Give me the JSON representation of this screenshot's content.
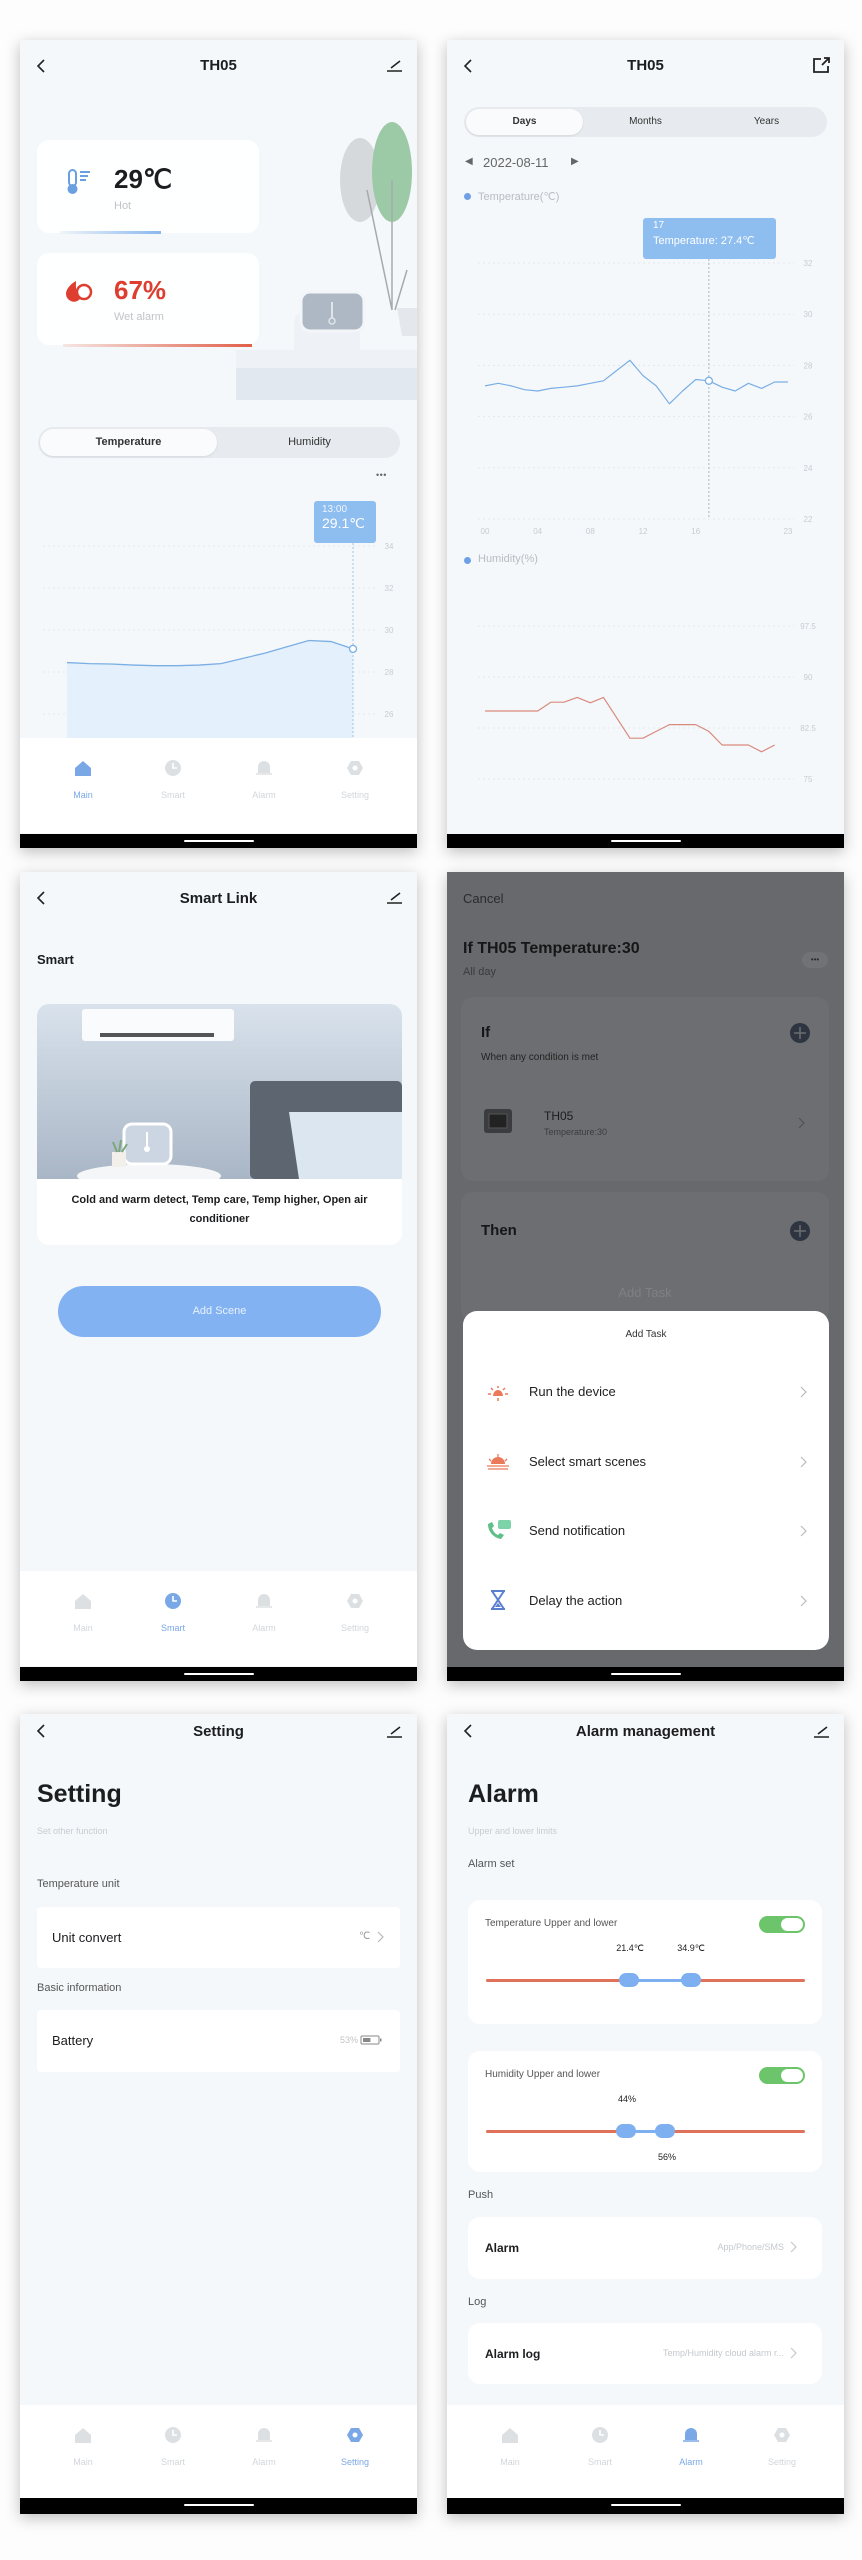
{
  "colors": {
    "accent": "#7aa8e6",
    "alarm": "#e04a3a",
    "toggle_on": "#6cc56a",
    "humidity_line": "#d98a7e",
    "temp_line": "#7aaee4"
  },
  "nav": {
    "items": [
      "Main",
      "Smart",
      "Alarm",
      "Setting"
    ],
    "icons": [
      "home-icon",
      "clock-icon",
      "bell-icon",
      "gear-icon"
    ]
  },
  "main": {
    "title": "TH05",
    "temperature": {
      "value": "29℃",
      "status": "Hot"
    },
    "humidity": {
      "value": "67%",
      "status": "Wet alarm"
    },
    "tabs": [
      "Temperature",
      "Humidity"
    ],
    "active_tab": 0,
    "more": "• • •",
    "tooltip": {
      "time": "13:00",
      "value": "29.1℃"
    },
    "nav_active": 0
  },
  "history": {
    "title": "TH05",
    "tabs": [
      "Days",
      "Months",
      "Years"
    ],
    "active_tab": 0,
    "date": "2022-08-11",
    "tooltip": {
      "hour": "17",
      "label": "Temperature: 27.4℃"
    }
  },
  "chart_data": [
    {
      "type": "area",
      "screen": "main",
      "yticks": [
        "34",
        "32",
        "30",
        "28",
        "26"
      ],
      "ylim": [
        26,
        34
      ],
      "grid": true,
      "x": [
        0,
        1,
        2,
        3,
        4,
        5,
        6,
        7,
        8,
        9,
        10,
        11,
        12,
        13
      ],
      "values": [
        28.45,
        28.4,
        28.38,
        28.33,
        28.3,
        28.3,
        28.33,
        28.4,
        28.65,
        28.9,
        29.2,
        29.5,
        29.45,
        29.1
      ],
      "highlight": {
        "x": 13,
        "y": 29.1
      }
    },
    {
      "type": "line",
      "screen": "history",
      "title": "Temperature(℃)",
      "ylim": [
        22,
        32
      ],
      "yticks": [
        "32",
        "30",
        "28",
        "26",
        "24",
        "22"
      ],
      "xticks": [
        "00",
        "04",
        "08",
        "12",
        "16",
        "23"
      ],
      "grid": true,
      "x": [
        0,
        1,
        2,
        3,
        4,
        5,
        6,
        7,
        8,
        9,
        10,
        11,
        12,
        13,
        14,
        15,
        16,
        17,
        18,
        19,
        20,
        21,
        22,
        23
      ],
      "values": [
        27.2,
        27.3,
        27.2,
        27.05,
        27.0,
        27.1,
        27.15,
        27.2,
        27.3,
        27.4,
        27.8,
        28.2,
        27.6,
        27.2,
        26.5,
        27.0,
        27.45,
        27.4,
        27.15,
        27.0,
        27.3,
        27.1,
        27.35,
        27.35
      ],
      "highlight": {
        "x": 17,
        "y": 27.4
      }
    },
    {
      "type": "line",
      "screen": "history",
      "title": "Humidity(%)",
      "ylim": [
        75,
        97.5
      ],
      "yticks": [
        "97.5",
        "90",
        "82.5",
        "75"
      ],
      "grid": true,
      "x": [
        0,
        1,
        2,
        3,
        4,
        5,
        6,
        7,
        8,
        9,
        10,
        11,
        12,
        13,
        14,
        15,
        16,
        17,
        18,
        19,
        20,
        21,
        22
      ],
      "values": [
        85,
        85,
        85,
        85,
        85,
        86.3,
        86.3,
        87,
        86.2,
        87,
        84,
        81,
        81,
        82,
        83,
        83,
        83,
        82,
        80,
        80,
        80,
        79,
        80
      ]
    }
  ],
  "smart": {
    "title": "Smart Link",
    "heading": "Smart",
    "card_caption": "Cold and warm detect, Temp care, Temp higher, Open air conditioner",
    "add_button": "Add Scene",
    "nav_active": 1
  },
  "scene": {
    "cancel": "Cancel",
    "title": "If TH05 Temperature:30",
    "subtitle": "All day",
    "more": "•••",
    "if_label": "If",
    "condition_mode": "When any condition is met",
    "condition": {
      "device": "TH05",
      "detail": "Temperature:30"
    },
    "then_label": "Then",
    "add_task_bg": "Add Task",
    "sheet": {
      "title": "Add Task",
      "items": [
        {
          "label": "Run the device",
          "icon": "lamp-icon"
        },
        {
          "label": "Select smart scenes",
          "icon": "sunrise-icon"
        },
        {
          "label": "Send notification",
          "icon": "phone-message-icon"
        },
        {
          "label": "Delay the action",
          "icon": "hourglass-icon"
        }
      ]
    }
  },
  "setting": {
    "title": "Setting",
    "heading": "Setting",
    "subtitle": "Set other function",
    "section1": "Temperature unit",
    "unit_label": "Unit convert",
    "unit_value": "℃",
    "section2": "Basic information",
    "battery_label": "Battery",
    "battery_value": "53%",
    "battery_level": 53,
    "nav_active": 3
  },
  "alarm": {
    "title": "Alarm management",
    "heading": "Alarm",
    "subtitle": "Upper and lower limits",
    "section_set": "Alarm set",
    "temp": {
      "label": "Temperature Upper and lower",
      "enabled": true,
      "low": 21.4,
      "high": 34.9,
      "low_text": "21.4℃",
      "high_text": "34.9℃",
      "range": [
        -10,
        60
      ]
    },
    "hum": {
      "label": "Humidity Upper and lower",
      "enabled": true,
      "low": 44,
      "high": 56,
      "low_text": "44%",
      "high_text": "56%",
      "range": [
        0,
        100
      ]
    },
    "section_push": "Push",
    "push_label": "Alarm",
    "push_value": "App/Phone/SMS",
    "section_log": "Log",
    "log_label": "Alarm log",
    "log_value": "Temp/Humidity cloud alarm r...",
    "nav_active": 2
  }
}
